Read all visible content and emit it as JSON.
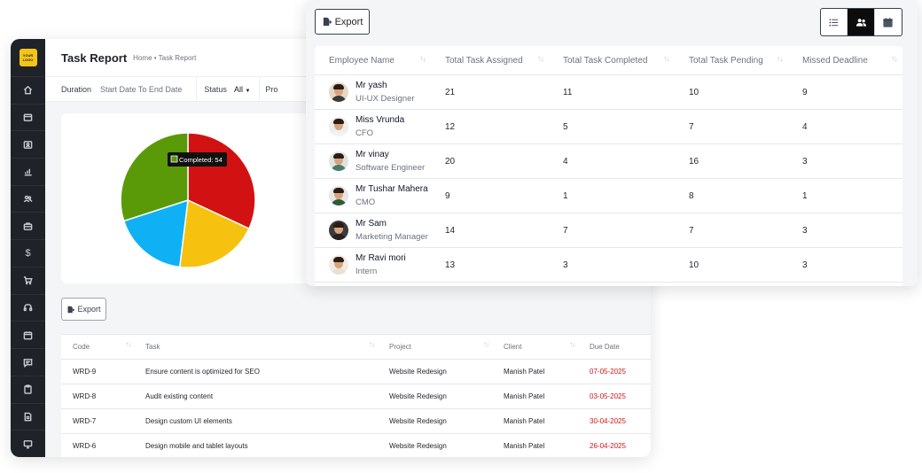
{
  "back": {
    "logo_line1": "YOUR",
    "logo_line2": "LOGO",
    "sidebar_icons": [
      "home-icon",
      "wallet-icon",
      "id-card-icon",
      "bar-chart-icon",
      "users-icon",
      "briefcase-icon",
      "dollar-icon",
      "cart-icon",
      "headset-icon",
      "calendar-icon",
      "chat-icon",
      "clipboard-icon",
      "document-icon",
      "monitor-icon"
    ],
    "title": "Task Report",
    "breadcrumb": "Home • Task Report",
    "filters": {
      "duration_label": "Duration",
      "duration_value": "Start Date To End Date",
      "status_label": "Status",
      "status_value": "All",
      "pro_label": "Pro"
    },
    "pie": {
      "tooltip": "Completed: 54",
      "slices": [
        {
          "name": "slice-red",
          "value": 115,
          "color": "#d21212"
        },
        {
          "name": "slice-yellow",
          "value": 72,
          "color": "#f6c20f"
        },
        {
          "name": "slice-blue",
          "value": 65,
          "color": "#0fb1f4"
        },
        {
          "name": "slice-green",
          "value": 108,
          "color": "#5a9a08"
        }
      ]
    },
    "export_label": "Export",
    "table": {
      "headers": [
        "Code",
        "Task",
        "Project",
        "Client",
        "Due Date"
      ],
      "rows": [
        [
          "WRD-9",
          "Ensure content is optimized for SEO",
          "Website Redesign",
          "Manish Patel",
          "07-05-2025"
        ],
        [
          "WRD-8",
          "Audit existing content",
          "Website Redesign",
          "Manish Patel",
          "03-05-2025"
        ],
        [
          "WRD-7",
          "Design custom UI elements",
          "Website Redesign",
          "Manish Patel",
          "30-04-2025"
        ],
        [
          "WRD-6",
          "Design mobile and tablet layouts",
          "Website Redesign",
          "Manish Patel",
          "26-04-2025"
        ]
      ]
    }
  },
  "front": {
    "export_label": "Export",
    "view_toggle": [
      "list-view-icon",
      "users-view-icon",
      "calendar-view-icon"
    ],
    "table": {
      "headers": [
        "Employee Name",
        "Total Task Assigned",
        "Total Task Completed",
        "Total Task Pending",
        "Missed Deadline"
      ],
      "rows": [
        {
          "name": "Mr yash",
          "role": "UI-UX Designer",
          "assigned": "21",
          "completed": "11",
          "pending": "10",
          "missed": "9",
          "shirt": "#3a3a3a",
          "bg": "#e5d8c8"
        },
        {
          "name": "Miss Vrunda",
          "role": "CFO",
          "assigned": "12",
          "completed": "5",
          "pending": "7",
          "missed": "4",
          "shirt": "#f2f2f2",
          "bg": "#eeeeee"
        },
        {
          "name": "Mr vinay",
          "role": "Software Engineer",
          "assigned": "20",
          "completed": "4",
          "pending": "16",
          "missed": "3",
          "shirt": "#4a7a6a",
          "bg": "#dfe4e2"
        },
        {
          "name": "Mr Tushar Mahera",
          "role": "CMO",
          "assigned": "9",
          "completed": "1",
          "pending": "8",
          "missed": "1",
          "shirt": "#2f5a3a",
          "bg": "#e7e7e7"
        },
        {
          "name": "Mr Sam",
          "role": "Marketing Manager",
          "assigned": "14",
          "completed": "7",
          "pending": "7",
          "missed": "3",
          "shirt": "#222222",
          "bg": "#3b3b3b"
        },
        {
          "name": "Mr Ravi mori",
          "role": "Intern",
          "assigned": "13",
          "completed": "3",
          "pending": "10",
          "missed": "3",
          "shirt": "#e8e0d4",
          "bg": "#f1ebe3"
        }
      ]
    }
  }
}
